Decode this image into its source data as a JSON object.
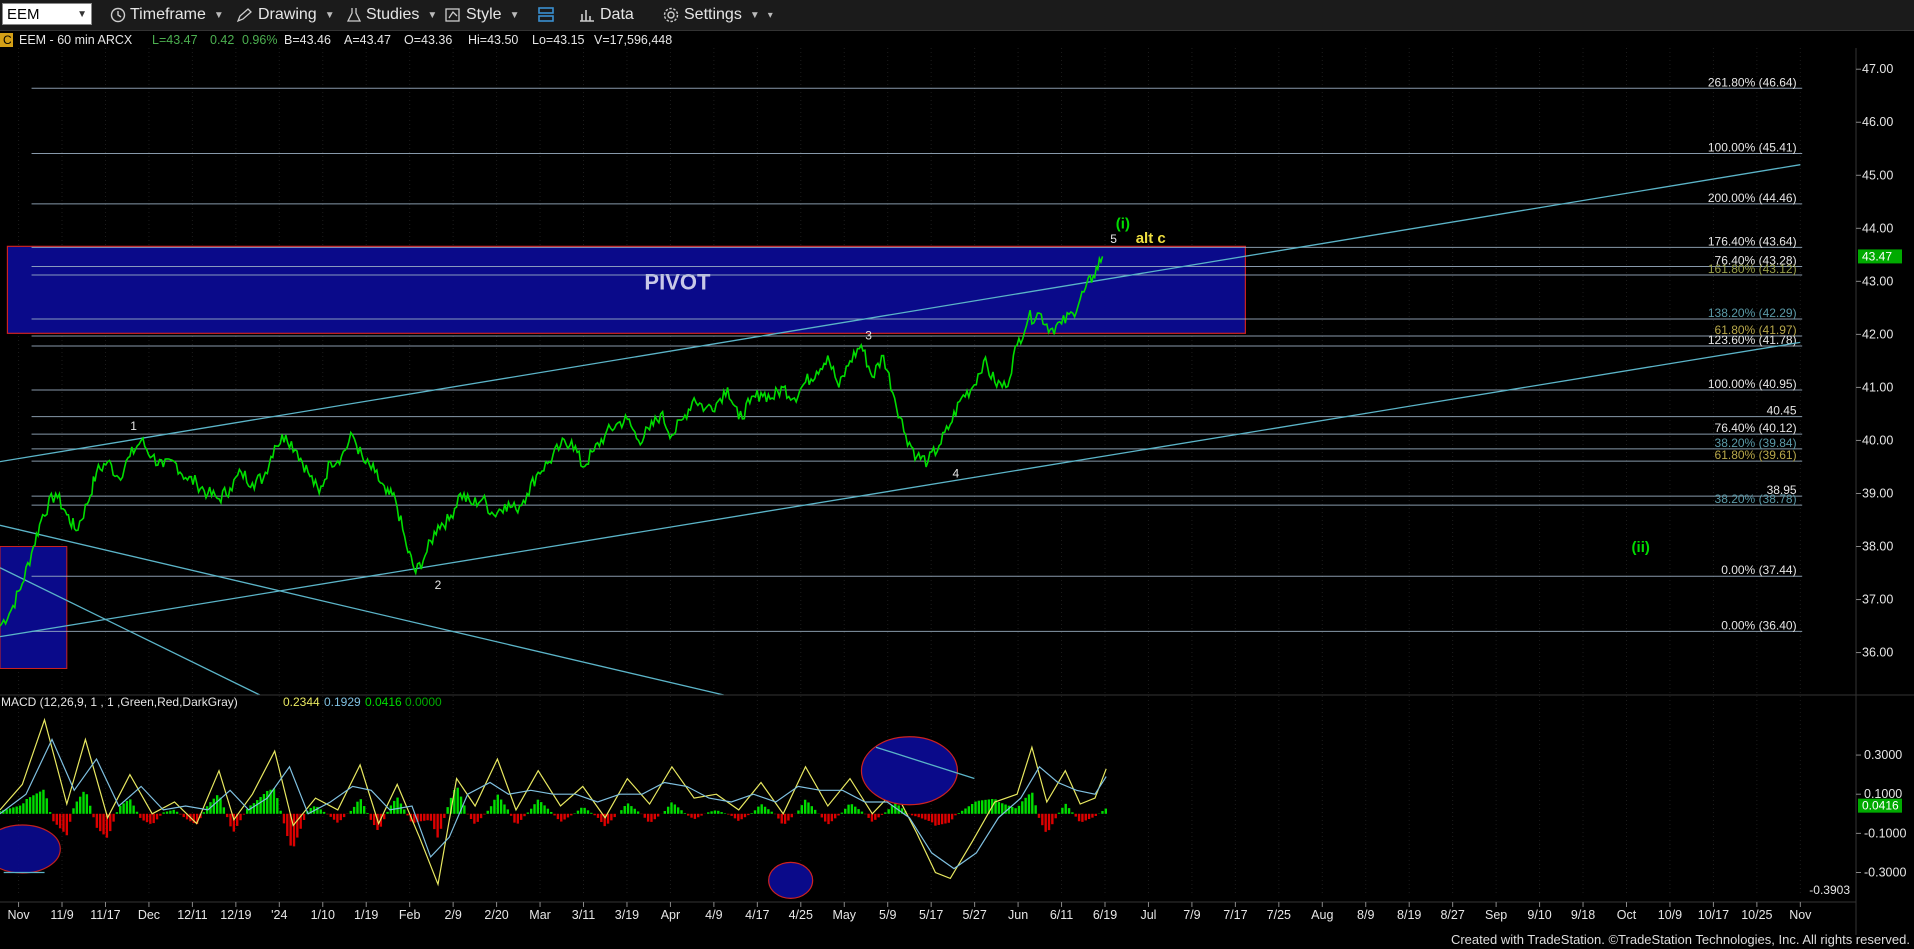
{
  "toolbar": {
    "symbol": "EEM",
    "timeframe_label": "Timeframe",
    "drawing_label": "Drawing",
    "studies_label": "Studies",
    "style_label": "Style",
    "data_label": "Data",
    "settings_label": "Settings",
    "icons": [
      "clock-icon",
      "pencil-icon",
      "flask-icon",
      "style-icon",
      "layout-icon",
      "bar-chart-icon",
      "gear-icon"
    ]
  },
  "header": {
    "c_badge": "C",
    "text": "EEM - 60 min  ARCX",
    "last": "L=43.47",
    "change": "0.42",
    "change_pct": "0.96%",
    "bid": "B=43.46",
    "ask": "A=43.47",
    "open": "O=43.36",
    "high": "Hi=43.50",
    "low": "Lo=43.15",
    "volume": "V=17,596,448"
  },
  "footer": "Created with TradeStation. ©TradeStation Technologies, Inc. All rights reserved.",
  "colors": {
    "background": "#000000",
    "price": "#00dd00",
    "fib_line": "#aabfd4",
    "trend_line": "#5bb4c8",
    "pivot_fill": "#0a0a8a",
    "pivot_border": "#cc2222",
    "macd_line": "#e8e860",
    "signal_line": "#7fc0e0",
    "hist_pos": "#00dd00",
    "hist_neg": "#dd0000",
    "current_price_tag": "#00aa00"
  },
  "chart_data": {
    "type": "line",
    "instrument": "EEM",
    "interval": "60 min",
    "y_ticks": [
      "47.00",
      "46.00",
      "45.00",
      "44.00",
      "43.00",
      "42.00",
      "41.00",
      "40.00",
      "39.00",
      "38.00",
      "37.00",
      "36.00"
    ],
    "ylim": [
      35.2,
      47.4
    ],
    "x_ticks": [
      "Nov",
      "11/9",
      "11/17",
      "Dec",
      "12/11",
      "12/19",
      "'24",
      "1/10",
      "1/19",
      "Feb",
      "2/9",
      "2/20",
      "Mar",
      "3/11",
      "3/19",
      "Apr",
      "4/9",
      "4/17",
      "4/25",
      "May",
      "5/9",
      "5/17",
      "5/27",
      "Jun",
      "6/11",
      "6/19",
      "Jul",
      "7/9",
      "7/17",
      "7/25",
      "Aug",
      "8/9",
      "8/19",
      "8/27",
      "Sep",
      "9/10",
      "9/18",
      "Oct",
      "10/9",
      "10/17",
      "10/25",
      "Nov"
    ],
    "last_price": "43.47",
    "price_path": [
      [
        0.0,
        36.5
      ],
      [
        0.6,
        36.8
      ],
      [
        1.2,
        37.3
      ],
      [
        1.8,
        38.0
      ],
      [
        2.3,
        38.6
      ],
      [
        3.0,
        39.0
      ],
      [
        3.6,
        38.6
      ],
      [
        4.1,
        38.3
      ],
      [
        4.7,
        38.8
      ],
      [
        5.2,
        39.4
      ],
      [
        5.8,
        39.6
      ],
      [
        6.4,
        39.3
      ],
      [
        7.0,
        39.7
      ],
      [
        7.6,
        40.0
      ],
      [
        8.2,
        39.7
      ],
      [
        8.8,
        39.5
      ],
      [
        9.4,
        39.6
      ],
      [
        10.0,
        39.3
      ],
      [
        10.6,
        39.2
      ],
      [
        11.2,
        39.0
      ],
      [
        11.8,
        38.9
      ],
      [
        12.4,
        39.1
      ],
      [
        13.0,
        39.4
      ],
      [
        13.6,
        39.2
      ],
      [
        14.2,
        39.3
      ],
      [
        14.8,
        39.9
      ],
      [
        15.4,
        40.1
      ],
      [
        16.0,
        39.8
      ],
      [
        16.6,
        39.4
      ],
      [
        17.2,
        39.0
      ],
      [
        17.8,
        39.6
      ],
      [
        18.4,
        39.7
      ],
      [
        19.0,
        40.1
      ],
      [
        19.6,
        39.6
      ],
      [
        20.2,
        39.4
      ],
      [
        20.8,
        39.0
      ],
      [
        21.3,
        38.9
      ],
      [
        21.9,
        38.0
      ],
      [
        22.4,
        37.5
      ],
      [
        23.0,
        37.9
      ],
      [
        23.6,
        38.4
      ],
      [
        24.2,
        38.5
      ],
      [
        24.8,
        39.0
      ],
      [
        25.4,
        38.8
      ],
      [
        26.0,
        38.9
      ],
      [
        26.6,
        38.6
      ],
      [
        27.2,
        38.8
      ],
      [
        27.8,
        38.7
      ],
      [
        28.4,
        39.0
      ],
      [
        29.0,
        39.4
      ],
      [
        29.6,
        39.6
      ],
      [
        30.2,
        39.9
      ],
      [
        30.8,
        40.0
      ],
      [
        31.4,
        39.5
      ],
      [
        32.0,
        39.8
      ],
      [
        32.6,
        40.1
      ],
      [
        33.2,
        40.3
      ],
      [
        33.8,
        40.4
      ],
      [
        34.4,
        40.0
      ],
      [
        35.0,
        40.2
      ],
      [
        35.6,
        40.5
      ],
      [
        36.2,
        40.1
      ],
      [
        36.8,
        40.4
      ],
      [
        37.4,
        40.8
      ],
      [
        38.0,
        40.6
      ],
      [
        38.6,
        40.7
      ],
      [
        39.2,
        41.0
      ],
      [
        39.8,
        40.4
      ],
      [
        40.4,
        40.7
      ],
      [
        41.0,
        40.9
      ],
      [
        41.6,
        40.8
      ],
      [
        42.2,
        41.0
      ],
      [
        42.8,
        40.8
      ],
      [
        43.4,
        41.1
      ],
      [
        44.0,
        41.3
      ],
      [
        44.6,
        41.6
      ],
      [
        45.2,
        41.0
      ],
      [
        45.8,
        41.5
      ],
      [
        46.4,
        41.8
      ],
      [
        47.0,
        41.2
      ],
      [
        47.6,
        41.6
      ],
      [
        48.2,
        40.8
      ],
      [
        48.8,
        40.1
      ],
      [
        49.4,
        39.7
      ],
      [
        50.0,
        39.6
      ],
      [
        50.6,
        39.9
      ],
      [
        51.2,
        40.3
      ],
      [
        51.8,
        40.8
      ],
      [
        52.4,
        41.0
      ],
      [
        53.0,
        41.5
      ],
      [
        53.6,
        41.1
      ],
      [
        54.2,
        41.0
      ],
      [
        54.8,
        41.8
      ],
      [
        55.4,
        42.3
      ],
      [
        56.0,
        42.4
      ],
      [
        56.6,
        42.1
      ],
      [
        57.2,
        42.2
      ],
      [
        57.8,
        42.4
      ],
      [
        58.4,
        42.8
      ],
      [
        58.9,
        43.1
      ],
      [
        59.4,
        43.47
      ]
    ],
    "wave_labels": [
      {
        "text": "1",
        "x": 7.2,
        "y": 40.2
      },
      {
        "text": "2",
        "x": 23.6,
        "y": 37.2
      },
      {
        "text": "3",
        "x": 46.8,
        "y": 41.9
      },
      {
        "text": "4",
        "x": 51.5,
        "y": 39.3
      },
      {
        "text": "5",
        "x": 60.0,
        "y": 43.72
      },
      {
        "text": "(i)",
        "x": 60.5,
        "y": 44.0
      },
      {
        "text": "alt c",
        "x": 62.0,
        "y": 43.72
      },
      {
        "text": "(ii)",
        "x": 88.4,
        "y": 37.9
      }
    ],
    "pivot_label": "PIVOT",
    "pivot_zone": [
      42.02,
      43.66
    ],
    "left_box_zone": [
      35.7,
      38.0
    ],
    "fib_levels": [
      {
        "label": "261.80% (46.64)",
        "value": 46.64,
        "color": "#e6e6e6"
      },
      {
        "label": "100.00% (45.41)",
        "value": 45.41,
        "color": "#e6e6e6"
      },
      {
        "label": "200.00% (44.46)",
        "value": 44.46,
        "color": "#e6e6e6"
      },
      {
        "label": "176.40% (43.64)",
        "value": 43.64,
        "color": "#e6e6e6"
      },
      {
        "label": "76.40% (43.28)",
        "value": 43.28,
        "color": "#e6e6e6"
      },
      {
        "label": "161.80% (43.12)",
        "value": 43.12,
        "color": "#9aa04a"
      },
      {
        "label": "138.20% (42.29)",
        "value": 42.29,
        "color": "#5b9aa8"
      },
      {
        "label": "61.80% (41.97)",
        "value": 41.97,
        "color": "#b8a84a"
      },
      {
        "label": "123.60% (41.78)",
        "value": 41.78,
        "color": "#e6e6e6"
      },
      {
        "label": "100.00% (40.95)",
        "value": 40.95,
        "color": "#e6e6e6"
      },
      {
        "label": "40.45",
        "value": 40.45,
        "color": "#e6e6e6"
      },
      {
        "label": "76.40% (40.12)",
        "value": 40.12,
        "color": "#e6e6e6"
      },
      {
        "label": "38.20% (39.84)",
        "value": 39.84,
        "color": "#5b9aa8"
      },
      {
        "label": "61.80% (39.61)",
        "value": 39.61,
        "color": "#b8a84a"
      },
      {
        "label": "38.95",
        "value": 38.95,
        "color": "#e6e6e6"
      },
      {
        "label": "38.20% (38.78)",
        "value": 38.78,
        "color": "#5b9aa8"
      },
      {
        "label": "0.00% (37.44)",
        "value": 37.44,
        "color": "#e6e6e6"
      },
      {
        "label": "0.00% (36.40)",
        "value": 36.4,
        "color": "#e6e6e6"
      }
    ],
    "trend_lines": [
      {
        "from": [
          0,
          39.6
        ],
        "to": [
          97,
          45.2
        ]
      },
      {
        "from": [
          0,
          36.3
        ],
        "to": [
          97,
          41.85
        ]
      },
      {
        "from": [
          0,
          38.4
        ],
        "to": [
          39,
          35.2
        ]
      },
      {
        "from": [
          14,
          35.2
        ],
        "to": [
          0,
          37.6
        ]
      }
    ],
    "macd": {
      "title": "MACD (12,26,9, 1 , 1 ,Green,Red,DarkGray)",
      "macd_value": "0.2344",
      "signal_value": "0.1929",
      "diff_value": "0.0416",
      "zero_value": "0.0000",
      "y_ticks": [
        "0.3000",
        "0.1000",
        "-0.1000",
        "-0.3000"
      ],
      "ylim": [
        -0.42,
        0.52
      ],
      "current_tag": "0.0416",
      "min_label": "-0.3903",
      "macd_path": [
        [
          0,
          0.02
        ],
        [
          1.2,
          0.15
        ],
        [
          2.4,
          0.48
        ],
        [
          3.6,
          0.05
        ],
        [
          4.6,
          0.38
        ],
        [
          5.8,
          -0.02
        ],
        [
          7.0,
          0.2
        ],
        [
          8.2,
          0.0
        ],
        [
          9.4,
          0.06
        ],
        [
          10.6,
          -0.05
        ],
        [
          11.8,
          0.22
        ],
        [
          12.6,
          -0.03
        ],
        [
          13.6,
          0.1
        ],
        [
          14.8,
          0.32
        ],
        [
          15.8,
          -0.06
        ],
        [
          17.0,
          0.08
        ],
        [
          18.2,
          0.02
        ],
        [
          19.4,
          0.25
        ],
        [
          20.4,
          -0.05
        ],
        [
          21.4,
          0.15
        ],
        [
          22.6,
          -0.12
        ],
        [
          23.6,
          -0.36
        ],
        [
          24.6,
          0.18
        ],
        [
          25.6,
          0.04
        ],
        [
          26.8,
          0.28
        ],
        [
          27.8,
          0.02
        ],
        [
          29.0,
          0.22
        ],
        [
          30.2,
          0.04
        ],
        [
          31.4,
          0.14
        ],
        [
          32.6,
          -0.02
        ],
        [
          33.8,
          0.18
        ],
        [
          35.0,
          0.05
        ],
        [
          36.2,
          0.24
        ],
        [
          37.4,
          0.08
        ],
        [
          38.6,
          0.1
        ],
        [
          39.8,
          0.02
        ],
        [
          41.0,
          0.16
        ],
        [
          42.2,
          0.0
        ],
        [
          43.4,
          0.24
        ],
        [
          44.6,
          0.04
        ],
        [
          45.8,
          0.18
        ],
        [
          47.0,
          0.0
        ],
        [
          48.2,
          0.12
        ],
        [
          49.4,
          -0.1
        ],
        [
          50.4,
          -0.3
        ],
        [
          51.2,
          -0.33
        ],
        [
          52.4,
          -0.14
        ],
        [
          53.6,
          0.06
        ],
        [
          54.8,
          0.1
        ],
        [
          55.6,
          0.34
        ],
        [
          56.4,
          0.06
        ],
        [
          57.4,
          0.22
        ],
        [
          58.2,
          0.05
        ],
        [
          59.0,
          0.08
        ],
        [
          59.6,
          0.23
        ]
      ],
      "signal_path": [
        [
          0,
          0.0
        ],
        [
          1.4,
          0.1
        ],
        [
          2.8,
          0.38
        ],
        [
          4.0,
          0.12
        ],
        [
          5.2,
          0.28
        ],
        [
          6.4,
          0.04
        ],
        [
          7.6,
          0.14
        ],
        [
          8.8,
          0.02
        ],
        [
          10.0,
          0.04
        ],
        [
          11.2,
          0.02
        ],
        [
          12.4,
          0.12
        ],
        [
          13.4,
          0.02
        ],
        [
          14.4,
          0.08
        ],
        [
          15.6,
          0.24
        ],
        [
          16.6,
          0.0
        ],
        [
          17.8,
          0.06
        ],
        [
          19.0,
          0.14
        ],
        [
          20.0,
          0.12
        ],
        [
          21.0,
          0.02
        ],
        [
          22.2,
          0.04
        ],
        [
          23.2,
          -0.22
        ],
        [
          24.2,
          -0.12
        ],
        [
          25.2,
          0.1
        ],
        [
          26.4,
          0.16
        ],
        [
          27.4,
          0.1
        ],
        [
          28.6,
          0.12
        ],
        [
          29.8,
          0.1
        ],
        [
          31.0,
          0.1
        ],
        [
          32.2,
          0.06
        ],
        [
          33.4,
          0.1
        ],
        [
          34.6,
          0.1
        ],
        [
          35.8,
          0.16
        ],
        [
          37.0,
          0.14
        ],
        [
          38.2,
          0.08
        ],
        [
          39.4,
          0.06
        ],
        [
          40.6,
          0.1
        ],
        [
          41.8,
          0.06
        ],
        [
          43.0,
          0.14
        ],
        [
          44.2,
          0.12
        ],
        [
          45.4,
          0.12
        ],
        [
          46.6,
          0.06
        ],
        [
          47.8,
          0.06
        ],
        [
          49.0,
          -0.02
        ],
        [
          50.2,
          -0.2
        ],
        [
          51.4,
          -0.28
        ],
        [
          52.6,
          -0.2
        ],
        [
          53.8,
          -0.02
        ],
        [
          55.0,
          0.08
        ],
        [
          56.0,
          0.24
        ],
        [
          57.0,
          0.16
        ],
        [
          58.0,
          0.12
        ],
        [
          59.0,
          0.1
        ],
        [
          59.6,
          0.19
        ]
      ]
    }
  }
}
